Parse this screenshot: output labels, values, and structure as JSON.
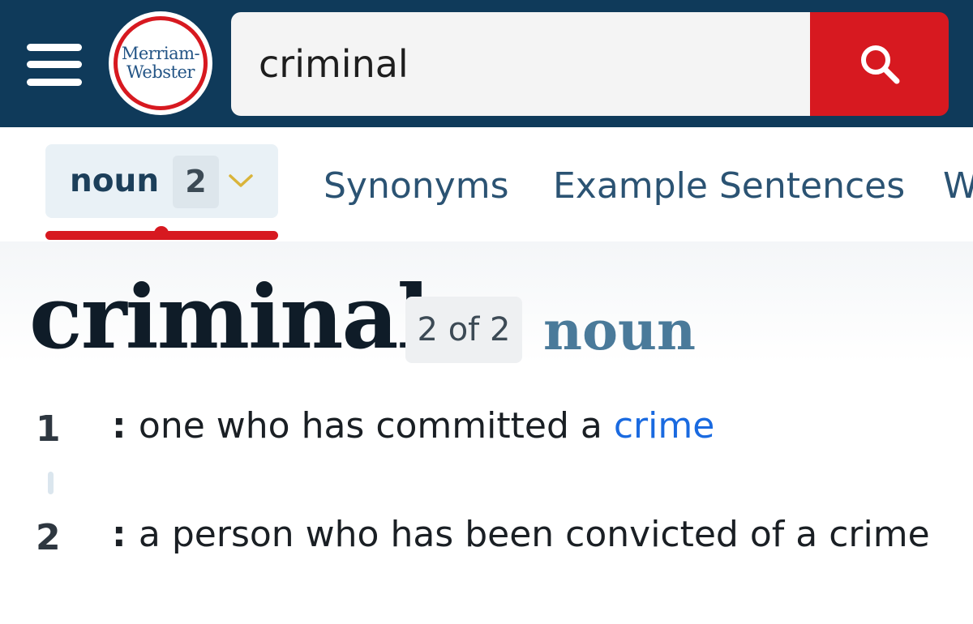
{
  "header": {
    "menu_icon": "hamburger-menu-icon",
    "logo": {
      "line1": "Merriam-",
      "line2": "Webster"
    },
    "search": {
      "value": "criminal",
      "button_icon": "search-icon"
    },
    "colors": {
      "background": "#0f3a5a",
      "search_button": "#d71920"
    }
  },
  "tabs": {
    "pos_dropdown": {
      "label": "noun",
      "count": "2",
      "icon": "chevron-down-icon"
    },
    "items": [
      "Synonyms",
      "Example Sentences",
      "W"
    ]
  },
  "entry": {
    "headword": "criminal",
    "entry_count": "2 of 2",
    "part_of_speech": "noun",
    "senses": [
      {
        "num": "1",
        "colon": ":",
        "text": "one who has committed a ",
        "xref": "crime"
      },
      {
        "num": "2",
        "colon": ":",
        "text": "a person who has been convicted of a crime"
      }
    ]
  }
}
